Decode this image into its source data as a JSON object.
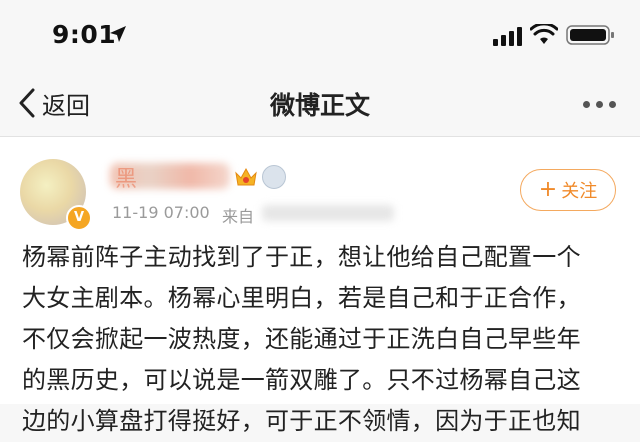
{
  "status_bar": {
    "time": "9:01"
  },
  "nav": {
    "back_label": "返回",
    "title": "微博正文"
  },
  "post": {
    "username": "黑",
    "timestamp": "11-19 07:00",
    "source": "来自",
    "follow_label": "关注",
    "text_lines": [
      "杨幂前阵子主动找到了于正，想让他给自己配置一个",
      "大女主剧本。杨幂心里明白，若是自己和于正合作，",
      "不仅会掀起一波热度，还能通过于正洗白自己早些年",
      "的黑历史，可以说是一箭双雕了。只不过杨幂自己这",
      "边的小算盘打得挺好，可于正不领情，因为于正也知"
    ]
  },
  "colors": {
    "accent": "#f08a2a",
    "text": "#222222",
    "meta": "#9a9a9a"
  }
}
